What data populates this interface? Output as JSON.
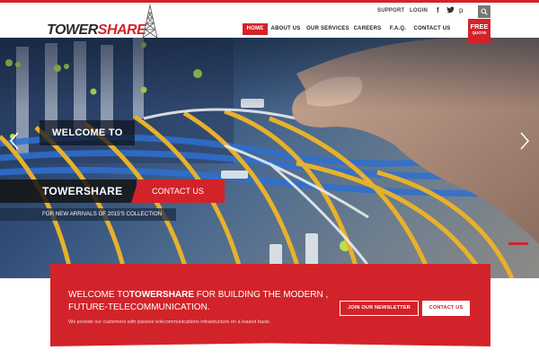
{
  "brand": {
    "logo_dark": "TOWER",
    "logo_red": "SHARE",
    "accent": "#d3232a"
  },
  "utility": {
    "support": "SUPPORT",
    "login": "LOGIN"
  },
  "social": {
    "facebook": "f",
    "twitter": "t",
    "pinterest": "p"
  },
  "nav": {
    "items": [
      "HOME",
      "ABOUT US",
      "OUR SERVICES",
      "CAREERS",
      "F.A.Q.",
      "CONTACT US"
    ],
    "active": "HOME"
  },
  "free_quote": {
    "line1": "FREE",
    "line2": "QUOTE"
  },
  "hero": {
    "welcome": "WELCOME TO",
    "brand": "TOWERSHARE",
    "contact": "CONTACT US",
    "tagline": "FOR NEW ARRIVALS OF 2015'S COLLECTION",
    "prev_icon": "chevron-left-icon",
    "next_icon": "chevron-right-icon"
  },
  "banner": {
    "pre": "WELCOME TO",
    "brand": "TOWERSHARE",
    "post": " FOR BUILDING THE MODERN ,",
    "line2": "FUTURE-TELECOMMUNICATION.",
    "sub": "We provide our customers with passive telecommunications infrastructure on a leased basis.",
    "newsletter_btn": "JOIN OUR NEWSLETTER",
    "contact_btn": "CONTACT US"
  }
}
